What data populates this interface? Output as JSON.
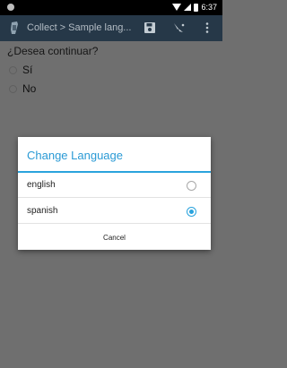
{
  "status_bar": {
    "time": "6:37",
    "icons": [
      "notification-dot-icon",
      "wifi-icon",
      "signal-icon",
      "battery-icon"
    ]
  },
  "app_bar": {
    "title": "Collect > Sample lang...",
    "icons": [
      "collect-app-icon",
      "save-icon",
      "navigate-icon",
      "overflow-menu-icon"
    ]
  },
  "form": {
    "question": "¿Desea continuar?",
    "options": [
      {
        "label": "Sí",
        "selected": false
      },
      {
        "label": "No",
        "selected": false
      }
    ]
  },
  "dialog": {
    "title": "Change Language",
    "options": [
      {
        "label": "english",
        "selected": false
      },
      {
        "label": "spanish",
        "selected": true
      }
    ],
    "cancel_label": "Cancel"
  },
  "colors": {
    "accent": "#2aa3dd",
    "app_bar": "#263848",
    "scrim_background": "#6f6f6f"
  }
}
